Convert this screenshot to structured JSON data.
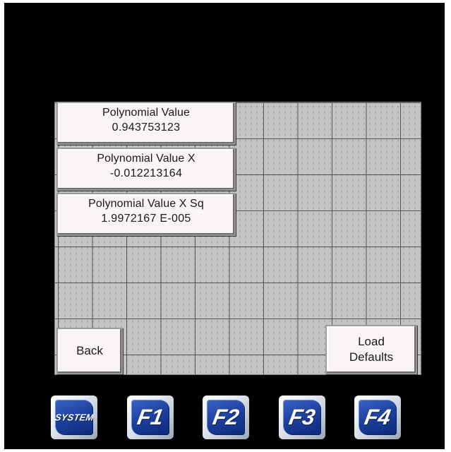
{
  "readouts": [
    {
      "label": "Polynomial Value",
      "value": "0.943753123"
    },
    {
      "label": "Polynomial Value X",
      "value": "-0.012213164"
    },
    {
      "label": "Polynomial Value X Sq",
      "value": "1.9972167 E-005"
    }
  ],
  "buttons": {
    "back_label": "Back",
    "load_defaults_line1": "Load",
    "load_defaults_line2": "Defaults"
  },
  "function_keys": [
    {
      "label": "SYSTEM",
      "icon": "system-key-icon"
    },
    {
      "label": "F1",
      "icon": "f1-key-icon"
    },
    {
      "label": "F2",
      "icon": "f2-key-icon"
    },
    {
      "label": "F3",
      "icon": "f3-key-icon"
    },
    {
      "label": "F4",
      "icon": "f4-key-icon"
    }
  ],
  "colors": {
    "screen_background": "#000000",
    "panel_background": "#c4c4c4",
    "readout_background": "#f8f4f8",
    "fkey_blue": "#1d3f9c"
  }
}
